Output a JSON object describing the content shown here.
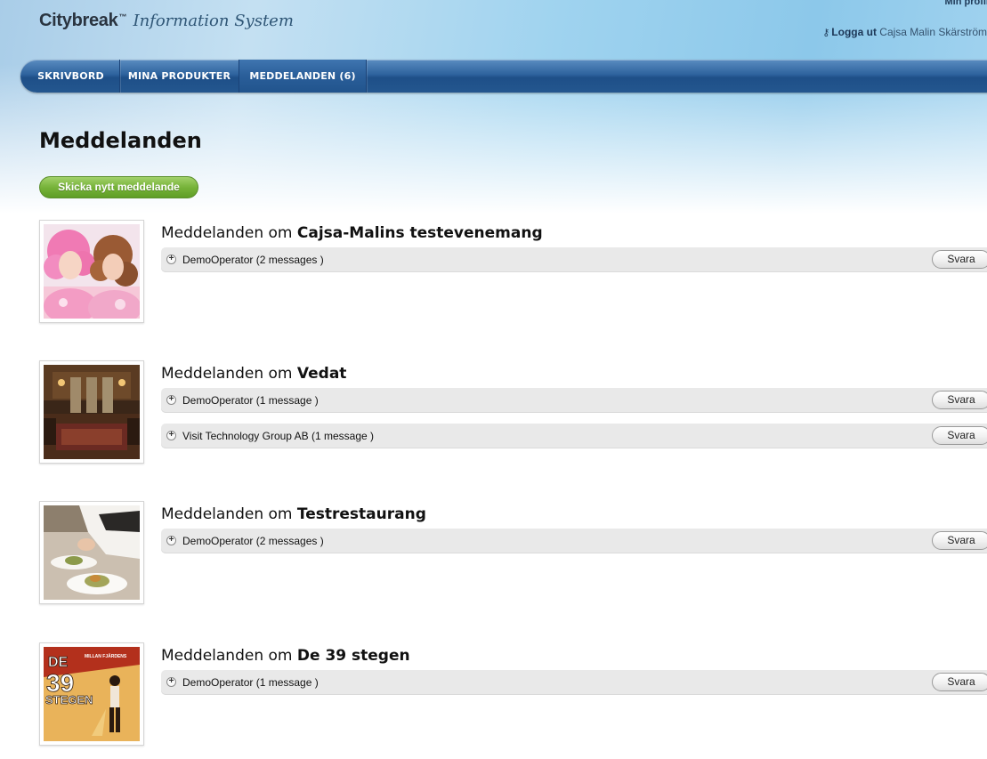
{
  "header": {
    "brand": "Citybreak",
    "trademark": "™",
    "tagline": "Information System",
    "profile_link": "Min profil",
    "logout_label": "Logga ut",
    "user_name": "Cajsa Malin Skärström"
  },
  "nav": {
    "items": [
      {
        "label": "SKRIVBORD"
      },
      {
        "label": "MINA PRODUKTER"
      },
      {
        "label": "MEDDELANDEN (6)"
      }
    ]
  },
  "page": {
    "title": "Meddelanden",
    "new_message_button": "Skicka nytt meddelande"
  },
  "groups": [
    {
      "prefix": "Meddelanden om ",
      "name": "Cajsa-Malins testevenemang",
      "threads": [
        {
          "label": "DemoOperator (2 messages )",
          "reply": "Svara"
        }
      ]
    },
    {
      "prefix": "Meddelanden om ",
      "name": "Vedat",
      "threads": [
        {
          "label": "DemoOperator (1 message )",
          "reply": "Svara"
        },
        {
          "label": "Visit Technology Group AB (1 message )",
          "reply": "Svara"
        }
      ]
    },
    {
      "prefix": "Meddelanden om ",
      "name": "Testrestaurang",
      "threads": [
        {
          "label": "DemoOperator (2 messages )",
          "reply": "Svara"
        }
      ]
    },
    {
      "prefix": "Meddelanden om ",
      "name": "De 39 stegen",
      "poster_text": {
        "word1": "DE",
        "number": "39",
        "word2": "STEGEN",
        "credit": "MILLAN FJÄRDENS"
      },
      "threads": [
        {
          "label": "DemoOperator (1 message )",
          "reply": "Svara"
        }
      ]
    }
  ]
}
